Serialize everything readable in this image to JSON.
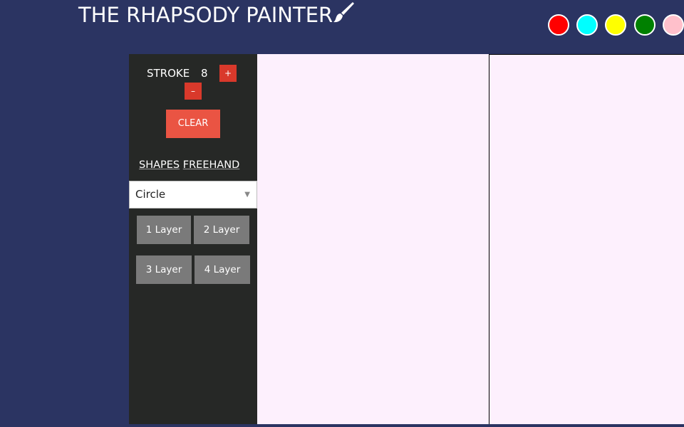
{
  "header": {
    "title": "THE RHAPSODY PAINTER",
    "icon": "paintbrush-icon"
  },
  "palette": {
    "colors": [
      "#ff0000",
      "#00ffff",
      "#ffff00",
      "#008000",
      "#ffc0cb"
    ]
  },
  "sidebar": {
    "stroke_label": "STROKE",
    "stroke_value": "8",
    "increase_label": "+",
    "decrease_label": "–",
    "clear_label": "CLEAR",
    "shapes_link": "SHAPES",
    "freehand_link": "FREEHAND",
    "shape_select": {
      "selected": "Circle"
    },
    "layers": [
      {
        "label": "1 Layer"
      },
      {
        "label": "2 Layer"
      },
      {
        "label": "3 Layer"
      },
      {
        "label": "4 Layer"
      }
    ]
  }
}
